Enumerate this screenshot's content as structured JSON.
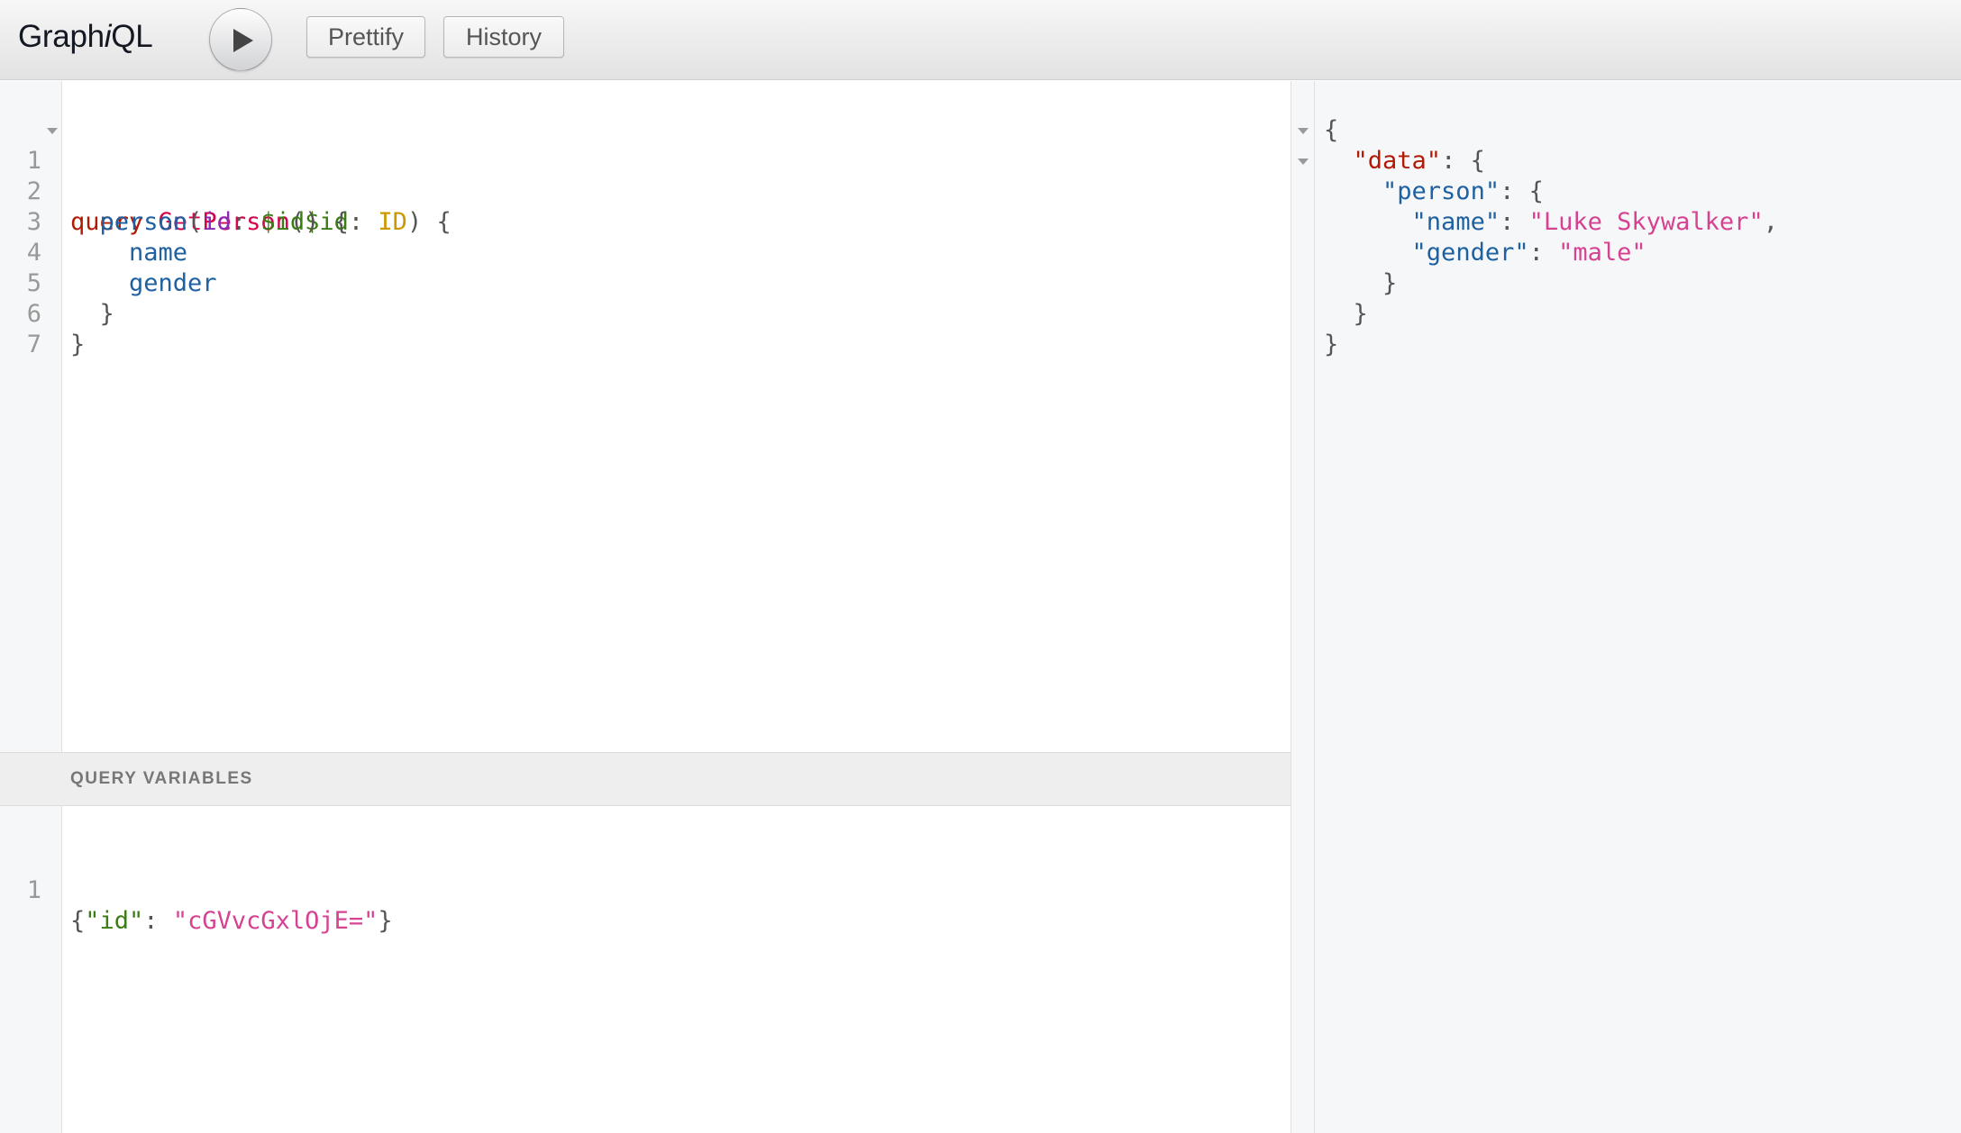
{
  "app": {
    "title_pre": "Graph",
    "title_i": "i",
    "title_post": "QL"
  },
  "toolbar": {
    "prettify_label": "Prettify",
    "history_label": "History"
  },
  "query_editor": {
    "line_numbers": [
      "1",
      "2",
      "3",
      "4",
      "5",
      "6",
      "7"
    ],
    "tokens": {
      "l1_kw": "query",
      "l1_def": "GetPerson",
      "l1_p1": "(",
      "l1_var": "$id",
      "l1_p2": ": ",
      "l1_type": "ID",
      "l1_p3": ") {",
      "l2_prop": "person",
      "l2_p1": "(",
      "l2_attr": "id",
      "l2_p2": ": ",
      "l2_var": "$id",
      "l2_p3": ") {",
      "l3_prop": "name",
      "l4_prop": "gender",
      "l5_p": "}",
      "l6_p": "}"
    }
  },
  "variables": {
    "header": "QUERY VARIABLES",
    "line_numbers": [
      "1"
    ],
    "tokens": {
      "p1": "{",
      "key": "\"id\"",
      "p2": ": ",
      "value": "\"cGVvcGxlOjE=\"",
      "p3": "}"
    }
  },
  "result": {
    "tokens": {
      "open": "{",
      "data_key": "\"data\"",
      "data_p": ": {",
      "person_key": "\"person\"",
      "person_p": ": {",
      "name_key": "\"name\"",
      "name_colon": ": ",
      "name_val": "\"Luke Skywalker\"",
      "name_comma": ",",
      "gender_key": "\"gender\"",
      "gender_colon": ": ",
      "gender_val": "\"male\"",
      "close1": "}",
      "close2": "}",
      "close3": "}"
    }
  },
  "icons": {
    "run": "play-icon",
    "fold": "fold-arrow-icon"
  }
}
